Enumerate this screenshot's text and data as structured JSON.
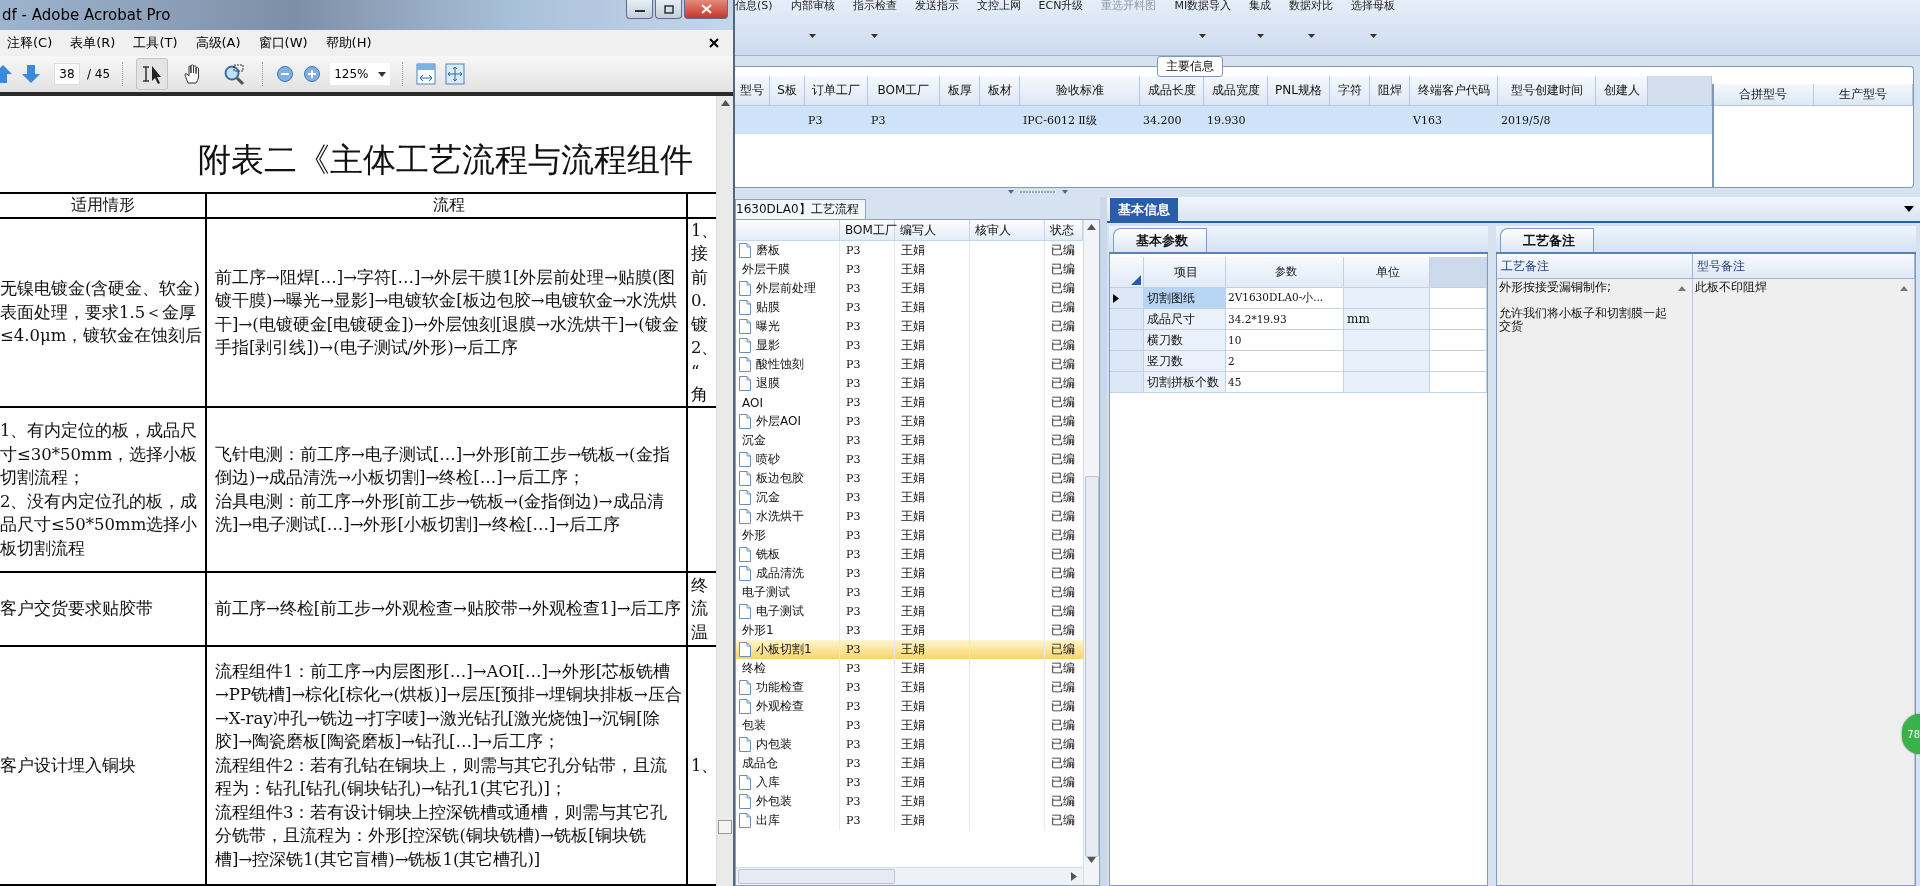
{
  "pdf_window": {
    "title": "df - Adobe Acrobat Pro",
    "menu": [
      "注释(C)",
      "表单(R)",
      "工具(T)",
      "高级(A)",
      "窗口(W)",
      "帮助(H)"
    ],
    "toolbar": {
      "page": "38",
      "page_count": "/ 45",
      "zoom": "125%",
      "tools": [
        {
          "kind": "select",
          "selected": true
        },
        {
          "kind": "hand",
          "selected": false
        },
        {
          "kind": "marquee_zoom",
          "selected": false
        }
      ]
    }
  },
  "document": {
    "title": "附表二《主体工艺流程与流程组件",
    "columns": [
      "适用情形",
      "流程"
    ],
    "rows": [
      {
        "condition": [
          "无镍电镀金(含硬金、软金)表面处理，要求1.5＜金厚≤4.0μm，镀软金在蚀刻后"
        ],
        "flow": [
          "前工序→阻焊[…]→字符[…]→外层干膜1[外层前处理→贴膜(图镀干膜)→曝光→显影]→电镀软金[板边包胶→电镀软金→水洗烘干]→(电镀硬金[电镀硬金])→外层蚀刻[退膜→水洗烘干]→(镀金手指[剥引线])→(电子测试/外形)→后工序"
        ],
        "column_3": [
          "1、",
          "接",
          "前",
          "0.",
          "镀",
          "2、",
          "“",
          "角"
        ]
      },
      {
        "condition": [
          "1、有内定位的板，成品尺寸≤30*50mm，选择小板切割流程；",
          "2、没有内定位孔的板，成品尺寸≤50*50mm选择小板切割流程"
        ],
        "flow": [
          "飞针电测：前工序→电子测试[…]→外形[前工步→铣板→(金指倒边)→成品清洗→小板切割]→终检[…]→后工序；",
          "治具电测：前工序→外形[前工步→铣板→(金指倒边)→成品清洗]→电子测试[…]→外形[小板切割]→终检[…]→后工序"
        ]
      },
      {
        "condition": [
          "客户交货要求贴胶带"
        ],
        "flow": [
          "前工序→终检[前工步→外观检查→贴胶带→外观检查1]→后工序"
        ],
        "column_3": [
          "终",
          "流",
          "温"
        ]
      },
      {
        "condition": [
          "客户设计埋入铜块"
        ],
        "flow": [
          "流程组件1：前工序→内层图形[…]→AOI[…]→外形[芯板铣槽→PP铣槽]→棕化[棕化→(烘板)]→层压[预排→埋铜块排板→压合→X-ray冲孔→铣边→打字唛]→激光钻孔[激光烧蚀]→沉铜[除胶]→陶瓷磨板[陶瓷磨板]→钻孔[…]→后工序；",
          "流程组件2：若有孔钻在铜块上，则需与其它孔分钻带，且流程为：钻孔[钻孔(铜块钻孔)→钻孔1(其它孔)]；",
          "流程组件3：若有设计铜块上控深铣槽或通槽，则需与其它孔分铣带，且流程为：外形[控深铣(铜块铣槽)→铣板[铜块铣槽]→控深铣1(其它盲槽)→铣板1(其它槽孔)]"
        ],
        "column_3": [
          "1、"
        ]
      }
    ]
  },
  "ribbon": [
    {
      "label": "信息(S)",
      "dropdown": false,
      "disabled": false
    },
    {
      "label": "内部审核",
      "dropdown": true,
      "disabled": false
    },
    {
      "label": "指示检查",
      "dropdown": true,
      "disabled": false
    },
    {
      "label": "发送指示",
      "dropdown": false,
      "disabled": false
    },
    {
      "label": "文控上网",
      "dropdown": false,
      "disabled": false
    },
    {
      "label": "ECN升级",
      "dropdown": false,
      "disabled": false
    },
    {
      "label": "重选开料图",
      "dropdown": false,
      "disabled": true
    },
    {
      "label": "MI数据导入",
      "dropdown": true,
      "disabled": false
    },
    {
      "label": "集成",
      "dropdown": true,
      "disabled": false
    },
    {
      "label": "数据对比",
      "dropdown": true,
      "disabled": false
    },
    {
      "label": "选择母板",
      "dropdown": true,
      "disabled": false
    }
  ],
  "main_info": {
    "legend": "主要信息",
    "columns": [
      "型号",
      "S板",
      "订单工厂",
      "BOM工厂",
      "板厚",
      "板材",
      "验收标准",
      "成品长度",
      "成品宽度",
      "PNL规格",
      "字符",
      "阻焊",
      "终端客户代码",
      "型号创建时间",
      "创建人"
    ],
    "rows": [
      {
        "selected": true,
        "cells": [
          null,
          null,
          "P3",
          "P3",
          null,
          null,
          "IPC-6012 Ⅱ级",
          "34.200",
          "19.930",
          null,
          null,
          null,
          "V163",
          "2019/5/8",
          null
        ]
      }
    ],
    "merge_columns": [
      "合拼型号",
      "生产型号"
    ]
  },
  "process": {
    "tab": "1630DLA0】工艺流程",
    "columns": [
      "BOM工厂",
      "编写人",
      "核审人",
      "状态"
    ],
    "items": [
      {
        "kind": "step",
        "name": "磨板",
        "bom": "P3",
        "author": "王娟",
        "status": "已编",
        "selected": false
      },
      {
        "kind": "group",
        "name": "外层干膜",
        "bom": "P3",
        "author": "王娟",
        "status": "已编",
        "selected": false,
        "children": [
          {
            "kind": "step",
            "name": "外层前处理",
            "bom": "P3",
            "author": "王娟",
            "status": "已编",
            "selected": false
          },
          {
            "kind": "step",
            "name": "贴膜",
            "bom": "P3",
            "author": "王娟",
            "status": "已编",
            "selected": false
          },
          {
            "kind": "step",
            "name": "曝光",
            "bom": "P3",
            "author": "王娟",
            "status": "已编",
            "selected": false
          },
          {
            "kind": "step",
            "name": "显影",
            "bom": "P3",
            "author": "王娟",
            "status": "已编",
            "selected": false
          },
          {
            "kind": "step",
            "name": "酸性蚀刻",
            "bom": "P3",
            "author": "王娟",
            "status": "已编",
            "selected": false
          },
          {
            "kind": "step",
            "name": "退膜",
            "bom": "P3",
            "author": "王娟",
            "status": "已编",
            "selected": false
          }
        ]
      },
      {
        "kind": "group",
        "name": "AOI",
        "bom": "P3",
        "author": "王娟",
        "status": "已编",
        "selected": false,
        "children": [
          {
            "kind": "step",
            "name": "外层AOI",
            "bom": "P3",
            "author": "王娟",
            "status": "已编",
            "selected": false
          }
        ]
      },
      {
        "kind": "group",
        "name": "沉金",
        "bom": "P3",
        "author": "王娟",
        "status": "已编",
        "selected": false,
        "children": [
          {
            "kind": "step",
            "name": "喷砂",
            "bom": "P3",
            "author": "王娟",
            "status": "已编",
            "selected": false
          },
          {
            "kind": "step",
            "name": "板边包胶",
            "bom": "P3",
            "author": "王娟",
            "status": "已编",
            "selected": false
          },
          {
            "kind": "step",
            "name": "沉金",
            "bom": "P3",
            "author": "王娟",
            "status": "已编",
            "selected": false
          },
          {
            "kind": "step",
            "name": "水洗烘干",
            "bom": "P3",
            "author": "王娟",
            "status": "已编",
            "selected": false
          }
        ]
      },
      {
        "kind": "group",
        "name": "外形",
        "bom": "P3",
        "author": "王娟",
        "status": "已编",
        "selected": false,
        "children": [
          {
            "kind": "step",
            "name": "铣板",
            "bom": "P3",
            "author": "王娟",
            "status": "已编",
            "selected": false
          },
          {
            "kind": "step",
            "name": "成品清洗",
            "bom": "P3",
            "author": "王娟",
            "status": "已编",
            "selected": false
          }
        ]
      },
      {
        "kind": "group",
        "name": "电子测试",
        "bom": "P3",
        "author": "王娟",
        "status": "已编",
        "selected": false,
        "children": [
          {
            "kind": "step",
            "name": "电子测试",
            "bom": "P3",
            "author": "王娟",
            "status": "已编",
            "selected": false
          }
        ]
      },
      {
        "kind": "group",
        "name": "外形1",
        "bom": "P3",
        "author": "王娟",
        "status": "已编",
        "selected": false,
        "children": [
          {
            "kind": "step",
            "name": "小板切割1",
            "bom": "P3",
            "author": "王娟",
            "status": "已编",
            "selected": true
          }
        ]
      },
      {
        "kind": "group",
        "name": "终检",
        "bom": "P3",
        "author": "王娟",
        "status": "已编",
        "selected": false,
        "children": [
          {
            "kind": "step",
            "name": "功能检查",
            "bom": "P3",
            "author": "王娟",
            "status": "已编",
            "selected": false
          },
          {
            "kind": "step",
            "name": "外观检查",
            "bom": "P3",
            "author": "王娟",
            "status": "已编",
            "selected": false
          }
        ]
      },
      {
        "kind": "group",
        "name": "包装",
        "bom": "P3",
        "author": "王娟",
        "status": "已编",
        "selected": false,
        "children": [
          {
            "kind": "step",
            "name": "内包装",
            "bom": "P3",
            "author": "王娟",
            "status": "已编",
            "selected": false
          }
        ]
      },
      {
        "kind": "group",
        "name": "成品仓",
        "bom": "P3",
        "author": "王娟",
        "status": "已编",
        "selected": false,
        "children": [
          {
            "kind": "step",
            "name": "入库",
            "bom": "P3",
            "author": "王娟",
            "status": "已编",
            "selected": false
          },
          {
            "kind": "step",
            "name": "外包装",
            "bom": "P3",
            "author": "王娟",
            "status": "已编",
            "selected": false
          },
          {
            "kind": "step",
            "name": "出库",
            "bom": "P3",
            "author": "王娟",
            "status": "已编",
            "selected": false
          }
        ]
      }
    ]
  },
  "basic_info": {
    "tab": "基本信息",
    "params_tab": "基本参数",
    "params_columns": [
      "项目",
      "参数",
      "单位"
    ],
    "params": [
      {
        "item": "切割图纸",
        "value": "2V1630DLA0-小...",
        "current": true,
        "selected": true
      },
      {
        "item": "成品尺寸",
        "value": "34.2*19.93",
        "unit": "mm",
        "current": false,
        "selected": false
      },
      {
        "item": "横刀数",
        "value": "10",
        "current": false,
        "selected": false
      },
      {
        "item": "竖刀数",
        "value": "2",
        "current": false,
        "selected": false
      },
      {
        "item": "切割拼板个数",
        "value": "45",
        "current": false,
        "selected": false
      }
    ],
    "notes_tab": "工艺备注",
    "notes_columns": [
      "工艺备注",
      "型号备注"
    ],
    "process_note": [
      "外形按接受漏铜制作;",
      "允许我们将小板子和切割膜一起交货"
    ],
    "model_note": "此板不印阻焊"
  },
  "badge": "78"
}
